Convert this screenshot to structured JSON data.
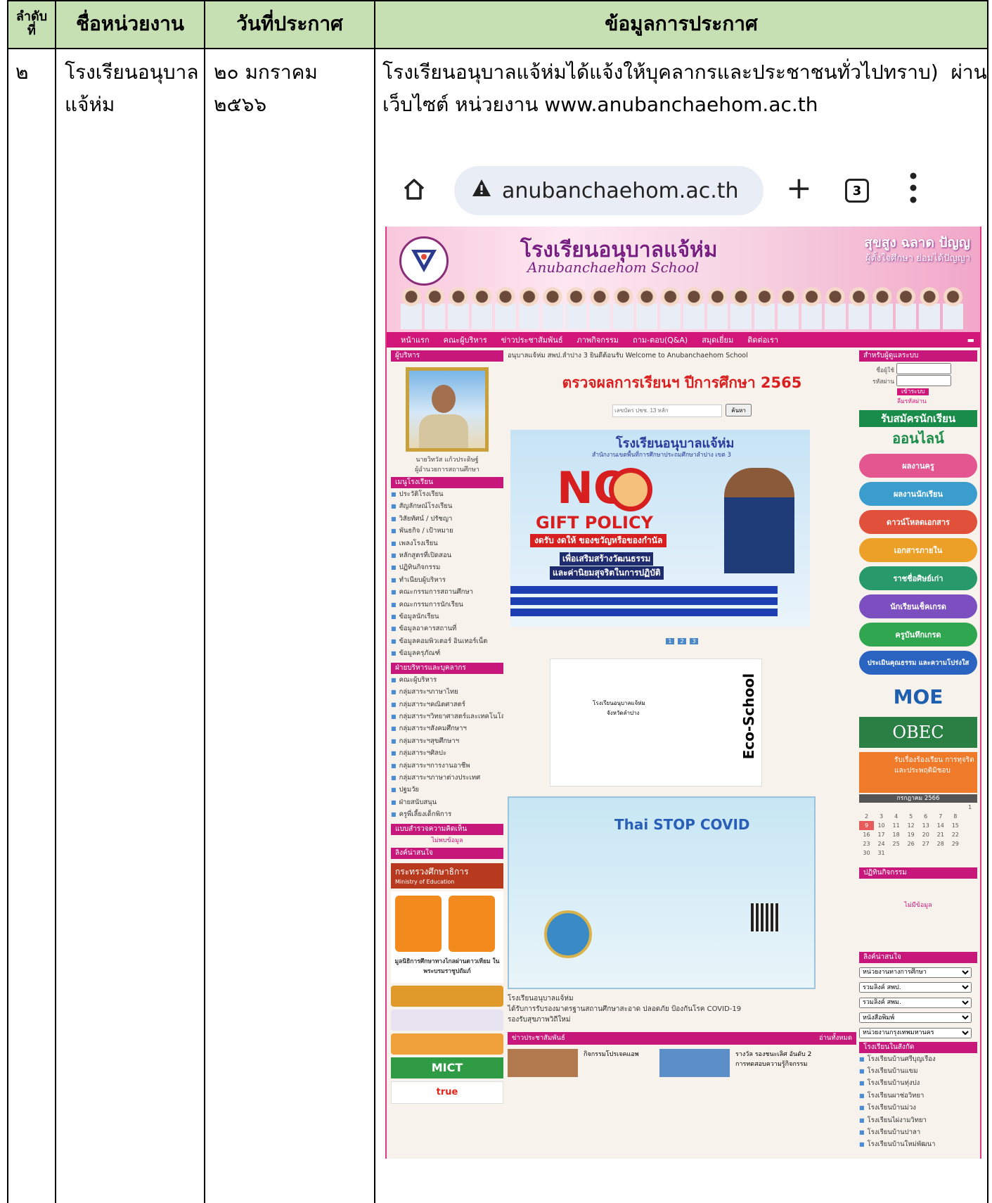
{
  "table": {
    "headers": {
      "no": "ลำดับ\nที่",
      "agency": "ชื่อหน่วยงาน",
      "date": "วันที่ประกาศ",
      "info": "ข้อมูลการประกาศ"
    },
    "row": {
      "no": "๒",
      "agency_line1": "โรงเรียนอนุบาล",
      "agency_line2": "แจ้ห่ม",
      "date_line1": "๒๐ มกราคม",
      "date_line2": "๒๕๖๖",
      "info_line1": "โรงเรียนอนุบาลแจ้ห่มได้แจ้งให้บุคลากรและประชาชนทั่วไปทราบ)  ผ่าน",
      "info_line2": "เว็บไซต์ หน่วยงาน www.anubanchaehom.ac.th"
    }
  },
  "browser": {
    "url": "anubanchaehom.ac.th",
    "tab_count": "3"
  },
  "site": {
    "title_th": "โรงเรียนอนุบาลแจ้ห่ม",
    "title_en": "Anubanchaehom School",
    "motto1": "สุขสูง ฉลาด ปัญญ",
    "motto2": "ผู้ตั้งใจศึกษา ย่อมได้ปัญญา",
    "nav": [
      "หน้าแรก",
      "คณะผู้บริหาร",
      "ข่าวประชาสัมพันธ์",
      "ภาพกิจกรรม",
      "ถาม-ตอบ(Q&A)",
      "สมุดเยี่ยม",
      "ติดต่อเรา"
    ],
    "left": {
      "admin_header": "ผู้บริหาร",
      "admin_name": "นายวิทวัส แก้วประดิษฐ์",
      "admin_role": "ผู้อำนวยการสถานศึกษา",
      "menu_header": "เมนูโรงเรียน",
      "menu": [
        "ประวัติโรงเรียน",
        "สัญลักษณ์โรงเรียน",
        "วิสัยทัศน์ / ปรัชญา",
        "พันธกิจ / เป้าหมาย",
        "เพลงโรงเรียน",
        "หลักสูตรที่เปิดสอน",
        "ปฏิทินกิจกรรม",
        "ทำเนียบผู้บริหาร",
        "คณะกรรมการสถานศึกษา",
        "คณะกรรมการนักเรียน",
        "ข้อมูลนักเรียน",
        "ข้อมูลอาคารสถานที่",
        "ข้อมูลคอมพิวเตอร์ อินเทอร์เน็ต",
        "ข้อมูลครุภัณฑ์"
      ],
      "staff_header": "ฝ่ายบริหารและบุคลากร",
      "staff": [
        "คณะผู้บริหาร",
        "กลุ่มสาระฯภาษาไทย",
        "กลุ่มสาระฯคณิตศาสตร์",
        "กลุ่มสาระฯวิทยาศาสตร์และเทคโนโลยี",
        "กลุ่มสาระฯสังคมศึกษาฯ",
        "กลุ่มสาระฯสุขศึกษาฯ",
        "กลุ่มสาระฯศิลปะ",
        "กลุ่มสาระฯการงานอาชีพ",
        "กลุ่มสาระฯภาษาต่างประเทศ",
        "ปฐมวัย",
        "ฝ่ายสนับสนุน",
        "ครูพี่เลี้ยงเด็กพิการ"
      ],
      "survey_header": "แบบสำรวจความคิดเห็น",
      "survey_empty": "ไม่พบข้อมูล",
      "links_header": "ลิงค์น่าสนใจ",
      "moe": "กระทรวงศึกษาธิการ",
      "moe_en": "Ministry of Education",
      "dltv": "มูลนิธิการศึกษาทางไกลผ่านดาวเทียม ในพระบรมราชูปถัมภ์",
      "mict": "MICT",
      "true": "true"
    },
    "mid": {
      "welcome": "อนุบาลแจ้ห่ม สพป.ลำปาง 3 ยินดีต้อนรับ Welcome to Anubanchaehom School",
      "result_title": "ตรวจผลการเรียนฯ ปีการศึกษา 2565",
      "search_placeholder": "เลขบัตร ปชช. 13 หลัก",
      "search_button": "ค้นหา",
      "poster_title": "โรงเรียนอนุบาลแจ้ห่ม",
      "poster_sub": "สำนักงานเขตพื้นที่การศึกษาประถมศึกษาลำปาง เขต 3",
      "no_gift": "NO",
      "gift_policy": "GIFT POLICY",
      "gift_th": "งดรับ งดให้ ของขวัญหรือของกำนัล",
      "virtue1": "เพื่อเสริมสร้างวัฒนธรรม",
      "virtue2": "และค่านิยมสุจริตในการปฏิบัติ",
      "pager": [
        "1",
        "2",
        "3"
      ],
      "eco": "Eco-School",
      "cert_school": "โรงเรียนอนุบาลแจ้ห่ม",
      "cert_province": "จังหวัดลำปาง",
      "thai_stop": "Thai STOP COVID",
      "news_caption1": "โรงเรียนอนุบาลแจ้ห่ม",
      "news_caption2": "ได้รับการรับรองมาตรฐานสถานศึกษาสะอาด ปลอดภัย ป้องกันโรค COVID-19",
      "news_caption3": "รองรับสุขภาพวิถีใหม่",
      "pr_header": "ข่าวประชาสัมพันธ์",
      "pr_more": "อ่านทั้งหมด",
      "pr_item1": "กิจกรรมโปรเจคแอพ",
      "pr_item2": "รางวัล รองชนะเลิศ อันดับ 2 การทดสอบความรู้กิจกรรม"
    },
    "right": {
      "login_header": "สำหรับผู้ดูแลระบบ",
      "user_label": "ชื่อผู้ใช้",
      "pass_label": "รหัสผ่าน",
      "login_button": "เข้าระบบ",
      "forgot": "ลืมรหัสผ่าน",
      "apply1": "รับสมัครนักเรียน",
      "apply2": "ออนไลน์",
      "buttons": [
        "ผลงานครู",
        "ผลงานนักเรียน",
        "ดาวน์โหลดเอกสาร",
        "เอกสารภายใน",
        "ราชชื่อศิษย์เก่า",
        "นักเรียนเช็คเกรด",
        "ครูบันทึกเกรด",
        "ประเมินคุณธรรม และความโปร่งใส"
      ],
      "moe_safety": "MOE",
      "obec": "OBEC",
      "complaint": "รับเรื่องร้องเรียน การทุจริตและประพฤติมิชอบ",
      "cal_month": "กรกฎาคม 2566",
      "calendar_header": "ปฏิทินกิจกรรม",
      "calendar_empty": "ไม่มีข้อมูล",
      "links_header": "ลิงค์น่าสนใจ",
      "selects": [
        "หน่วยงานทางการศึกษา",
        "รวมลิงค์ สพป.",
        "รวมลิงค์ สพม.",
        "หนังสือพิมพ์",
        "หน่วยงานกรุงเทพมหานคร"
      ],
      "network_header": "โรงเรียนในสังกัด",
      "network": [
        "โรงเรียนบ้านศรีบุญเรือง",
        "โรงเรียนบ้านแขม",
        "โรงเรียนบ้านทุ่งปง",
        "โรงเรียนผาช่อวิทยา",
        "โรงเรียนบ้านม่วง",
        "โรงเรียนไผ่งามวิทยา",
        "โรงเรียนบ้านปาลา",
        "โรงเรียนบ้านใหม่พัฒนา"
      ]
    }
  },
  "colors": {
    "header_bg": "#c6e0b4",
    "site_pink": "#d21679"
  }
}
